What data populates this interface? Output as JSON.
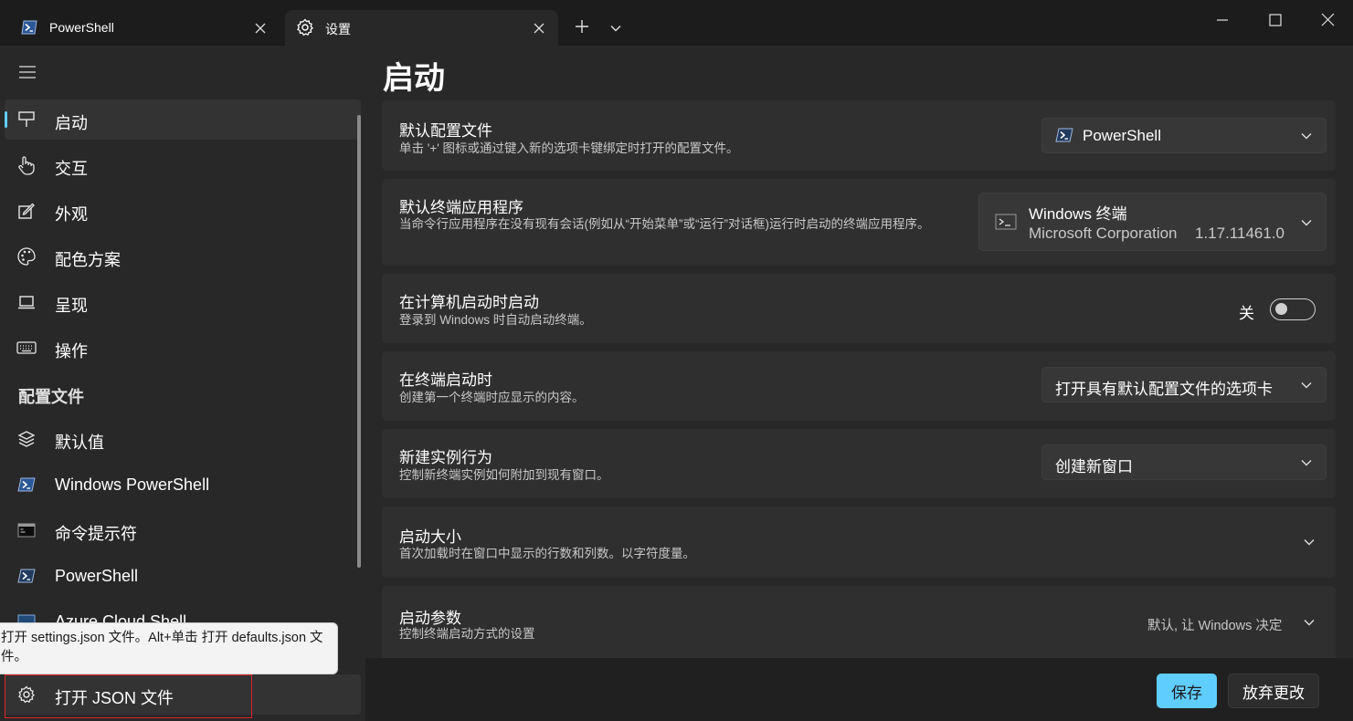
{
  "tabs": [
    {
      "label": "PowerShell",
      "icon": "powershell-icon",
      "active": false
    },
    {
      "label": "设置",
      "icon": "gear-icon",
      "active": true
    }
  ],
  "colors": {
    "accent": "#60cdff",
    "highlight_border": "#e0242a"
  },
  "sidebar": {
    "items": [
      {
        "label": "启动",
        "icon": "startup-icon",
        "selected": true
      },
      {
        "label": "交互",
        "icon": "hand-pointer-icon"
      },
      {
        "label": "外观",
        "icon": "appearance-edit-icon"
      },
      {
        "label": "配色方案",
        "icon": "palette-icon"
      },
      {
        "label": "呈现",
        "icon": "monitor-icon"
      },
      {
        "label": "操作",
        "icon": "keyboard-icon"
      }
    ],
    "profiles_header": "配置文件",
    "profiles": [
      {
        "label": "默认值",
        "icon": "layers-icon"
      },
      {
        "label": "Windows PowerShell",
        "icon": "powershell-icon"
      },
      {
        "label": "命令提示符",
        "icon": "cmd-icon"
      },
      {
        "label": "PowerShell",
        "icon": "powershell-icon"
      },
      {
        "label": "Azure Cloud Shell",
        "icon": "azure-icon"
      }
    ],
    "open_json_label": "打开 JSON 文件",
    "tooltip_text": "打开 settings.json 文件。Alt+单击 打开 defaults.json 文件。"
  },
  "page": {
    "title": "启动",
    "settings": [
      {
        "title": "默认配置文件",
        "desc": "单击 '+' 图标或通过键入新的选项卡键绑定时打开的配置文件。",
        "value": "PowerShell"
      },
      {
        "title": "默认终端应用程序",
        "desc": "当命令行应用程序在没有现有会话(例如从“开始菜单”或“运行”对话框)运行时启动的终端应用程序。",
        "value_name": "Windows 终端",
        "value_publisher": "Microsoft Corporation",
        "value_version": "1.17.11461.0"
      },
      {
        "title": "在计算机启动时启动",
        "desc": "登录到 Windows 时自动启动终端。",
        "toggle_label": "关",
        "toggle_on": false
      },
      {
        "title": "在终端启动时",
        "desc": "创建第一个终端时应显示的内容。",
        "value": "打开具有默认配置文件的选项卡"
      },
      {
        "title": "新建实例行为",
        "desc": "控制新终端实例如何附加到现有窗口。",
        "value": "创建新窗口"
      },
      {
        "title": "启动大小",
        "desc": "首次加载时在窗口中显示的行数和列数。以字符度量。"
      },
      {
        "title": "启动参数",
        "desc": "控制终端启动方式的设置",
        "value": "默认, 让 Windows 决定"
      }
    ]
  },
  "footer": {
    "save_label": "保存",
    "discard_label": "放弃更改"
  }
}
